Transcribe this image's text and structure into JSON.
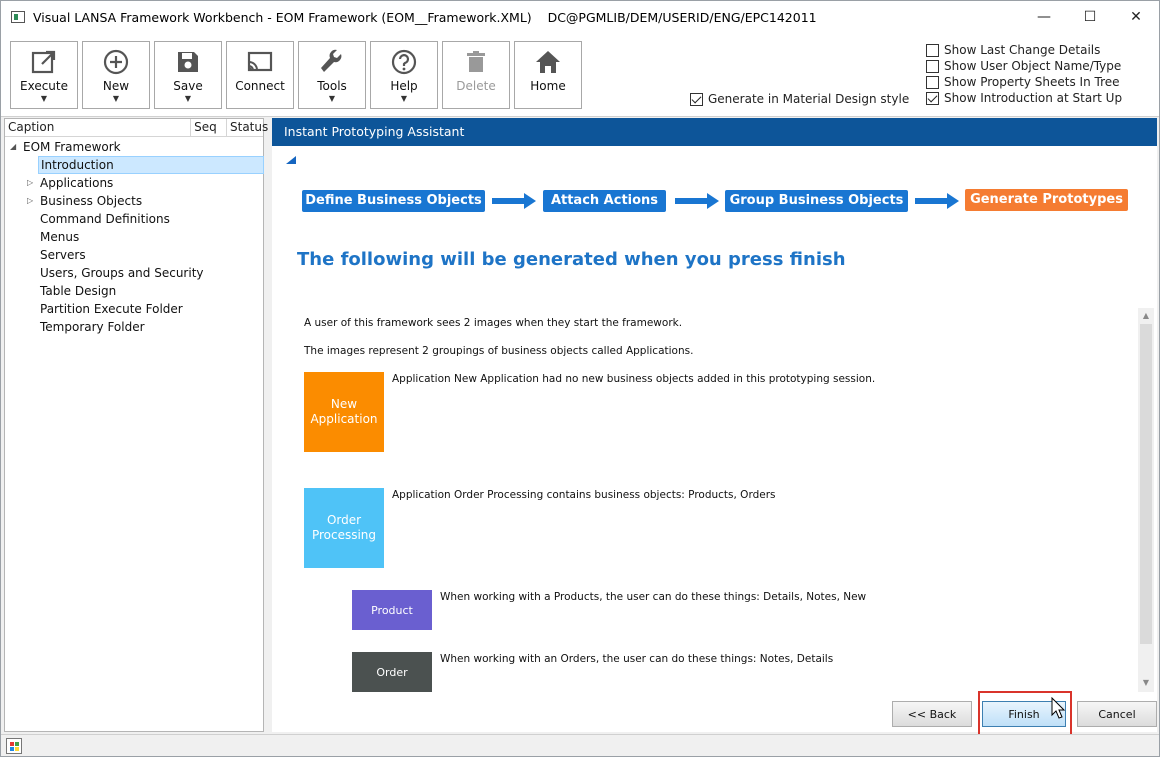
{
  "window": {
    "title": "Visual LANSA Framework Workbench - EOM Framework (EOM__Framework.XML)    DC@PGMLIB/DEM/USERID/ENG/EPC142011",
    "controls": {
      "minimize": "—",
      "maximize": "☐",
      "close": "✕"
    }
  },
  "toolbar": {
    "buttons": [
      {
        "label": "Execute",
        "icon": "external-link-icon",
        "dropdown": true
      },
      {
        "label": "New",
        "icon": "plus-circle-icon",
        "dropdown": true
      },
      {
        "label": "Save",
        "icon": "floppy-disk-icon",
        "dropdown": true
      },
      {
        "label": "Connect",
        "icon": "cast-icon",
        "dropdown": false
      },
      {
        "label": "Tools",
        "icon": "wrench-icon",
        "dropdown": true
      },
      {
        "label": "Help",
        "icon": "question-circle-icon",
        "dropdown": true
      },
      {
        "label": "Delete",
        "icon": "trash-icon",
        "dropdown": false,
        "disabled": true
      },
      {
        "label": "Home",
        "icon": "home-icon",
        "dropdown": false
      }
    ],
    "dropdown_glyph": "▼",
    "material_design": {
      "label": "Generate in Material Design style",
      "checked": true
    },
    "options": [
      {
        "label": "Show Last Change Details",
        "checked": false
      },
      {
        "label": "Show User Object Name/Type",
        "checked": false
      },
      {
        "label": "Show Property Sheets In Tree",
        "checked": false
      },
      {
        "label": "Show Introduction at Start Up",
        "checked": true
      }
    ]
  },
  "tree": {
    "columns": [
      "Caption",
      "Seq",
      "Status"
    ],
    "root": "EOM Framework",
    "items": [
      {
        "label": "Introduction",
        "selected": true,
        "expandable": false
      },
      {
        "label": "Applications",
        "selected": false,
        "expandable": true
      },
      {
        "label": "Business Objects",
        "selected": false,
        "expandable": true
      },
      {
        "label": "Command Definitions",
        "selected": false,
        "expandable": false
      },
      {
        "label": "Menus",
        "selected": false,
        "expandable": false
      },
      {
        "label": "Servers",
        "selected": false,
        "expandable": false
      },
      {
        "label": "Users, Groups and Security",
        "selected": false,
        "expandable": false
      },
      {
        "label": "Table Design",
        "selected": false,
        "expandable": false
      },
      {
        "label": "Partition Execute Folder",
        "selected": false,
        "expandable": false
      },
      {
        "label": "Temporary Folder",
        "selected": false,
        "expandable": false
      }
    ]
  },
  "panel": {
    "title": "Instant Prototyping Assistant",
    "steps": [
      {
        "label": "Define Business Objects",
        "active": false
      },
      {
        "label": "Attach Actions",
        "active": false
      },
      {
        "label": "Group Business Objects",
        "active": false
      },
      {
        "label": "Generate Prototypes",
        "active": true
      }
    ],
    "heading": "The following will be generated when you press finish",
    "intro1": "A user of this framework sees 2 images when they start the framework.",
    "intro2": "The images represent 2 groupings of business objects called Applications.",
    "applications": [
      {
        "tile": "New Application",
        "color": "#fb8c00",
        "text": "Application New Application had no new business objects added in this prototyping session."
      },
      {
        "tile": "Order Processing",
        "color": "#4fc3f7",
        "text": "Application Order Processing contains business objects: Products, Orders"
      }
    ],
    "business_objects": [
      {
        "tile": "Product",
        "color": "#6a5fd0",
        "text": "When working with a Products, the user can do these things: Details, Notes, New"
      },
      {
        "tile": "Order",
        "color": "#4b5150",
        "text": "When working with an Orders, the user can do these things: Notes, Details"
      }
    ],
    "buttons": {
      "back": "<< Back",
      "finish": "Finish",
      "cancel": "Cancel"
    }
  },
  "colors": {
    "header_blue": "#0d5599",
    "step_blue": "#1976d2",
    "step_active": "#f57c32",
    "heading_blue": "#1e74c6"
  }
}
